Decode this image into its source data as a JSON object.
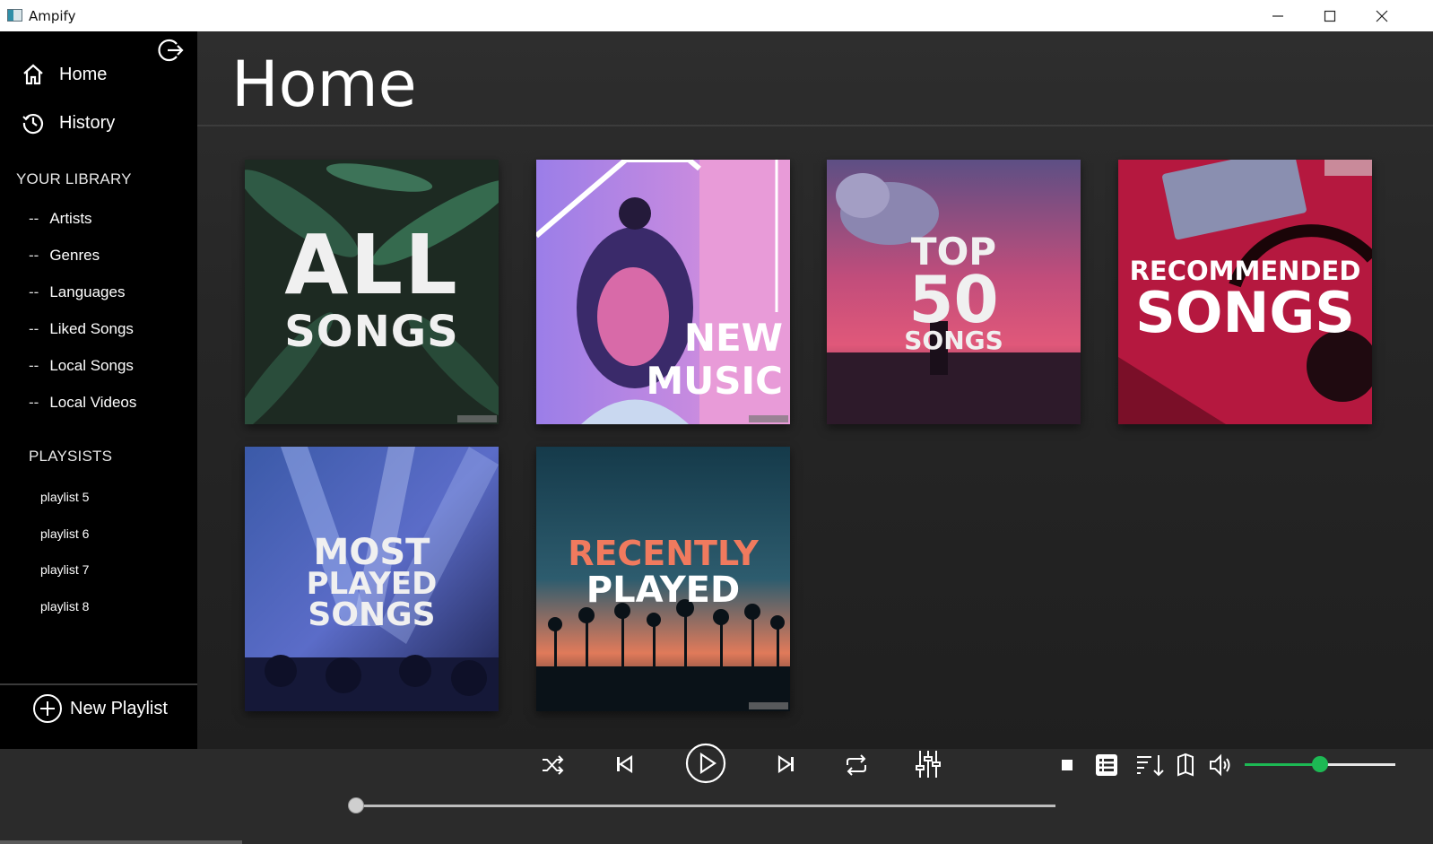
{
  "window": {
    "title": "Ampify"
  },
  "sidebar": {
    "nav": [
      {
        "label": "Home",
        "icon": "home-icon"
      },
      {
        "label": "History",
        "icon": "history-icon"
      }
    ],
    "library_title": "YOUR LIBRARY",
    "library": [
      {
        "label": "Artists"
      },
      {
        "label": "Genres"
      },
      {
        "label": "Languages"
      },
      {
        "label": "Liked Songs"
      },
      {
        "label": "Local Songs"
      },
      {
        "label": "Local Videos"
      }
    ],
    "library_prefix": "--",
    "playlists_title": "PLAYSISTS",
    "playlists": [
      {
        "label": "playlist 5"
      },
      {
        "label": "playlist 6"
      },
      {
        "label": "playlist 7"
      },
      {
        "label": "playlist 8"
      }
    ],
    "new_playlist_label": "New Playlist"
  },
  "main": {
    "title": "Home",
    "cards": [
      {
        "line1": "ALL",
        "line2": "SONGS"
      },
      {
        "line1": "NEW",
        "line2": "MUSIC"
      },
      {
        "line1": "TOP",
        "line2": "50",
        "line3": "SONGS"
      },
      {
        "line1": "RECOMMENDED",
        "line2": "SONGS"
      },
      {
        "line1": "MOST",
        "line2": "PLAYED",
        "line3": "SONGS"
      },
      {
        "line1": "RECENTLY",
        "line2": "PLAYED"
      }
    ]
  },
  "player": {
    "seek_fraction": 0.0,
    "volume_fraction": 0.5,
    "accent_color": "#1db954"
  }
}
